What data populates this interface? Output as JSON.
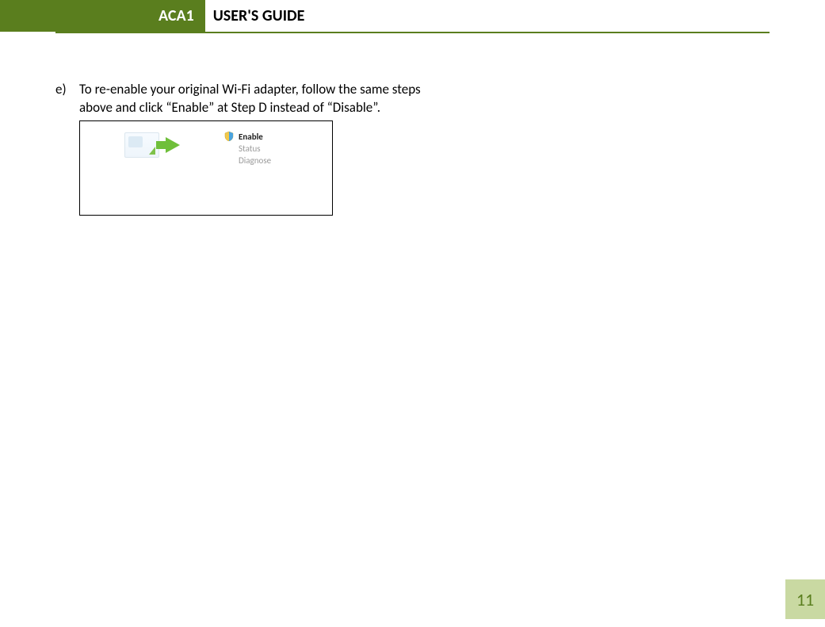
{
  "header": {
    "badge": "ACA1",
    "title": "USER'S GUIDE"
  },
  "body": {
    "item_marker": "e)",
    "item_text": "To re-enable your original Wi-Fi adapter, follow the same steps above and click “Enable” at Step D instead of “Disable”."
  },
  "context_menu": {
    "enable": "Enable",
    "status": "Status",
    "diagnose": "Diagnose"
  },
  "page_number": "11"
}
